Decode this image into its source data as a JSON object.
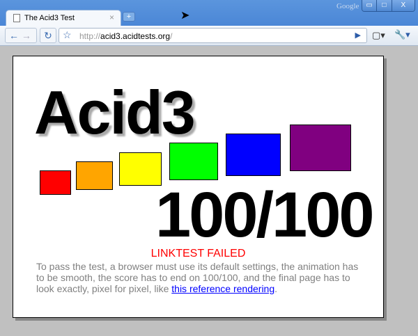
{
  "window": {
    "brand": "Google",
    "minimize": "▭",
    "maximize": "□",
    "close": "X"
  },
  "tab": {
    "title": "The Acid3 Test",
    "close": "×",
    "new_tab": "+"
  },
  "toolbar": {
    "back": "←",
    "forward": "→",
    "reload": "↻",
    "url_scheme": "http://",
    "url_host": "acid3.acidtests.org",
    "url_path": "/",
    "go": "▶",
    "page_menu": "▢▾",
    "tools_menu": "🔧▾"
  },
  "page": {
    "heading": "Acid3",
    "score": "100/100",
    "status": "LINKTEST FAILED",
    "description_before": "To pass the test, a browser must use its default settings, the animation has to be smooth, the score has to end on 100/100, and the final page has to look exactly, pixel for pixel, like ",
    "link": "this reference rendering",
    "description_after": ".",
    "bucket_colors": [
      "#ff0000",
      "#ffa500",
      "#ffff00",
      "#00ff00",
      "#0000ff",
      "#800080"
    ]
  }
}
